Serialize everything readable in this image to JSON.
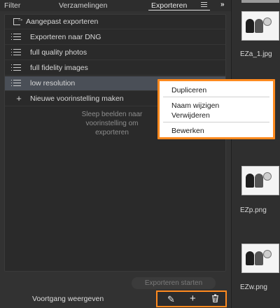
{
  "tabs": {
    "filter": "Filter",
    "collections": "Verzamelingen",
    "export": "Exporteren",
    "expand": "»"
  },
  "presets": [
    {
      "label": "Aangepast exporteren",
      "icon": "export-icon"
    },
    {
      "label": "Exporteren naar DNG",
      "icon": "list-icon"
    },
    {
      "label": "full quality photos",
      "icon": "list-icon"
    },
    {
      "label": "full fidelity images",
      "icon": "list-icon"
    },
    {
      "label": "low resolution",
      "icon": "list-icon",
      "selected": true
    },
    {
      "label": "Nieuwe voorinstelling maken",
      "icon": "plus-icon"
    }
  ],
  "hint": {
    "line1": "Sleep beelden naar",
    "line2": "voorinstelling om",
    "line3": "exporteren"
  },
  "context_menu": {
    "duplicate": "Dupliceren",
    "rename": "Naam wijzigen",
    "delete": "Verwijderen",
    "edit": "Bewerken"
  },
  "footer": {
    "export_start": "Exporteren starten",
    "show_progress": "Voortgang weergeven"
  },
  "thumbnails": [
    {
      "name": "EZa_1.jpg"
    },
    {
      "name": "EZp.png"
    },
    {
      "name": "EZw.png"
    }
  ],
  "colors": {
    "highlight": "#ff8a1f",
    "selected_row": "#4a4f57",
    "panel": "#323232"
  }
}
